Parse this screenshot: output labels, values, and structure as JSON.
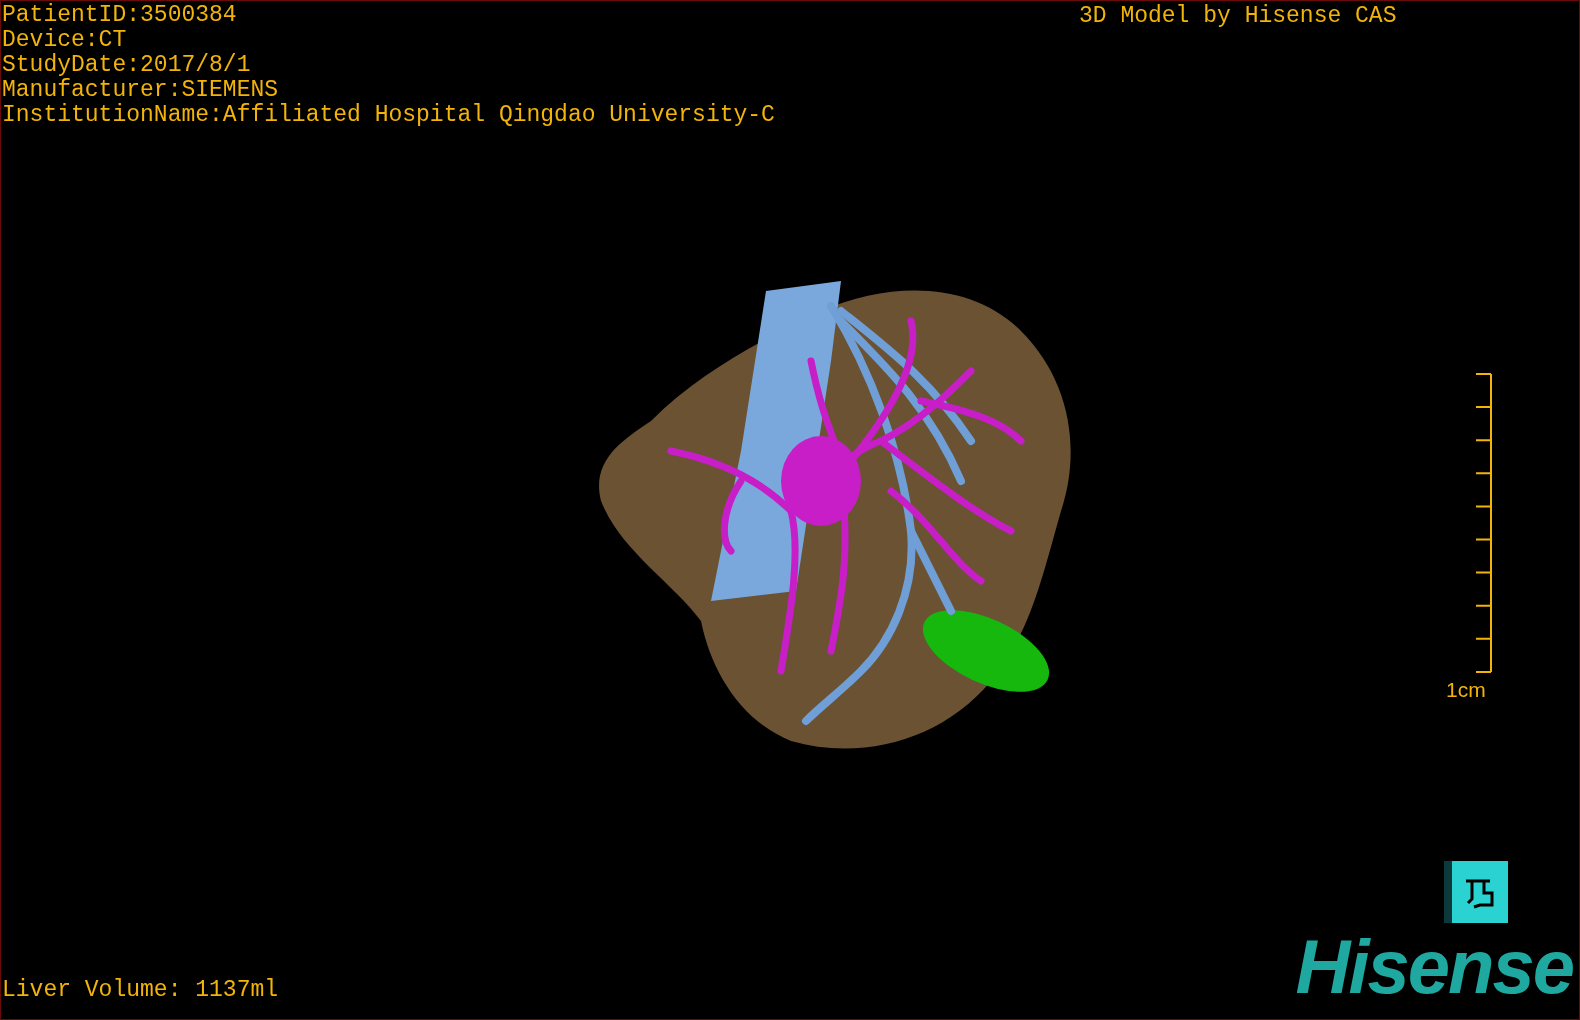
{
  "patient_info": [
    "PatientID:3500384",
    "Device:CT",
    "StudyDate:2017/8/1",
    "Manufacturer:SIEMENS",
    "InstitutionName:Affiliated Hospital Qingdao University-C"
  ],
  "title": "3D Model by Hisense CAS",
  "scale_bar": {
    "label": "1cm"
  },
  "liver_volume": "Liver Volume: 1137ml",
  "logo": "Hisense"
}
